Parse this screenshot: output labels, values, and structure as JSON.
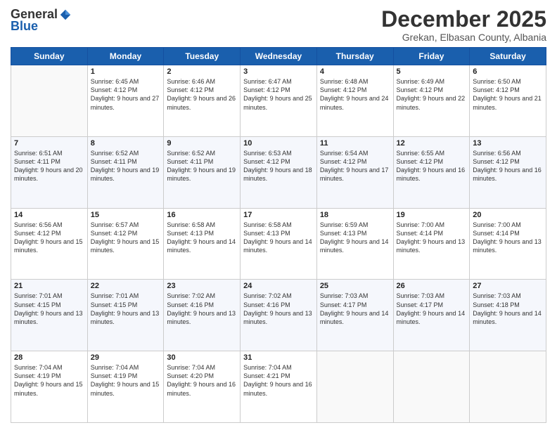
{
  "logo": {
    "general": "General",
    "blue": "Blue"
  },
  "title": "December 2025",
  "subtitle": "Grekan, Elbasan County, Albania",
  "days_header": [
    "Sunday",
    "Monday",
    "Tuesday",
    "Wednesday",
    "Thursday",
    "Friday",
    "Saturday"
  ],
  "weeks": [
    [
      {
        "day": "",
        "sunrise": "",
        "sunset": "",
        "daylight": ""
      },
      {
        "day": "1",
        "sunrise": "Sunrise: 6:45 AM",
        "sunset": "Sunset: 4:12 PM",
        "daylight": "Daylight: 9 hours and 27 minutes."
      },
      {
        "day": "2",
        "sunrise": "Sunrise: 6:46 AM",
        "sunset": "Sunset: 4:12 PM",
        "daylight": "Daylight: 9 hours and 26 minutes."
      },
      {
        "day": "3",
        "sunrise": "Sunrise: 6:47 AM",
        "sunset": "Sunset: 4:12 PM",
        "daylight": "Daylight: 9 hours and 25 minutes."
      },
      {
        "day": "4",
        "sunrise": "Sunrise: 6:48 AM",
        "sunset": "Sunset: 4:12 PM",
        "daylight": "Daylight: 9 hours and 24 minutes."
      },
      {
        "day": "5",
        "sunrise": "Sunrise: 6:49 AM",
        "sunset": "Sunset: 4:12 PM",
        "daylight": "Daylight: 9 hours and 22 minutes."
      },
      {
        "day": "6",
        "sunrise": "Sunrise: 6:50 AM",
        "sunset": "Sunset: 4:12 PM",
        "daylight": "Daylight: 9 hours and 21 minutes."
      }
    ],
    [
      {
        "day": "7",
        "sunrise": "Sunrise: 6:51 AM",
        "sunset": "Sunset: 4:11 PM",
        "daylight": "Daylight: 9 hours and 20 minutes."
      },
      {
        "day": "8",
        "sunrise": "Sunrise: 6:52 AM",
        "sunset": "Sunset: 4:11 PM",
        "daylight": "Daylight: 9 hours and 19 minutes."
      },
      {
        "day": "9",
        "sunrise": "Sunrise: 6:52 AM",
        "sunset": "Sunset: 4:11 PM",
        "daylight": "Daylight: 9 hours and 19 minutes."
      },
      {
        "day": "10",
        "sunrise": "Sunrise: 6:53 AM",
        "sunset": "Sunset: 4:12 PM",
        "daylight": "Daylight: 9 hours and 18 minutes."
      },
      {
        "day": "11",
        "sunrise": "Sunrise: 6:54 AM",
        "sunset": "Sunset: 4:12 PM",
        "daylight": "Daylight: 9 hours and 17 minutes."
      },
      {
        "day": "12",
        "sunrise": "Sunrise: 6:55 AM",
        "sunset": "Sunset: 4:12 PM",
        "daylight": "Daylight: 9 hours and 16 minutes."
      },
      {
        "day": "13",
        "sunrise": "Sunrise: 6:56 AM",
        "sunset": "Sunset: 4:12 PM",
        "daylight": "Daylight: 9 hours and 16 minutes."
      }
    ],
    [
      {
        "day": "14",
        "sunrise": "Sunrise: 6:56 AM",
        "sunset": "Sunset: 4:12 PM",
        "daylight": "Daylight: 9 hours and 15 minutes."
      },
      {
        "day": "15",
        "sunrise": "Sunrise: 6:57 AM",
        "sunset": "Sunset: 4:12 PM",
        "daylight": "Daylight: 9 hours and 15 minutes."
      },
      {
        "day": "16",
        "sunrise": "Sunrise: 6:58 AM",
        "sunset": "Sunset: 4:13 PM",
        "daylight": "Daylight: 9 hours and 14 minutes."
      },
      {
        "day": "17",
        "sunrise": "Sunrise: 6:58 AM",
        "sunset": "Sunset: 4:13 PM",
        "daylight": "Daylight: 9 hours and 14 minutes."
      },
      {
        "day": "18",
        "sunrise": "Sunrise: 6:59 AM",
        "sunset": "Sunset: 4:13 PM",
        "daylight": "Daylight: 9 hours and 14 minutes."
      },
      {
        "day": "19",
        "sunrise": "Sunrise: 7:00 AM",
        "sunset": "Sunset: 4:14 PM",
        "daylight": "Daylight: 9 hours and 13 minutes."
      },
      {
        "day": "20",
        "sunrise": "Sunrise: 7:00 AM",
        "sunset": "Sunset: 4:14 PM",
        "daylight": "Daylight: 9 hours and 13 minutes."
      }
    ],
    [
      {
        "day": "21",
        "sunrise": "Sunrise: 7:01 AM",
        "sunset": "Sunset: 4:15 PM",
        "daylight": "Daylight: 9 hours and 13 minutes."
      },
      {
        "day": "22",
        "sunrise": "Sunrise: 7:01 AM",
        "sunset": "Sunset: 4:15 PM",
        "daylight": "Daylight: 9 hours and 13 minutes."
      },
      {
        "day": "23",
        "sunrise": "Sunrise: 7:02 AM",
        "sunset": "Sunset: 4:16 PM",
        "daylight": "Daylight: 9 hours and 13 minutes."
      },
      {
        "day": "24",
        "sunrise": "Sunrise: 7:02 AM",
        "sunset": "Sunset: 4:16 PM",
        "daylight": "Daylight: 9 hours and 13 minutes."
      },
      {
        "day": "25",
        "sunrise": "Sunrise: 7:03 AM",
        "sunset": "Sunset: 4:17 PM",
        "daylight": "Daylight: 9 hours and 14 minutes."
      },
      {
        "day": "26",
        "sunrise": "Sunrise: 7:03 AM",
        "sunset": "Sunset: 4:17 PM",
        "daylight": "Daylight: 9 hours and 14 minutes."
      },
      {
        "day": "27",
        "sunrise": "Sunrise: 7:03 AM",
        "sunset": "Sunset: 4:18 PM",
        "daylight": "Daylight: 9 hours and 14 minutes."
      }
    ],
    [
      {
        "day": "28",
        "sunrise": "Sunrise: 7:04 AM",
        "sunset": "Sunset: 4:19 PM",
        "daylight": "Daylight: 9 hours and 15 minutes."
      },
      {
        "day": "29",
        "sunrise": "Sunrise: 7:04 AM",
        "sunset": "Sunset: 4:19 PM",
        "daylight": "Daylight: 9 hours and 15 minutes."
      },
      {
        "day": "30",
        "sunrise": "Sunrise: 7:04 AM",
        "sunset": "Sunset: 4:20 PM",
        "daylight": "Daylight: 9 hours and 16 minutes."
      },
      {
        "day": "31",
        "sunrise": "Sunrise: 7:04 AM",
        "sunset": "Sunset: 4:21 PM",
        "daylight": "Daylight: 9 hours and 16 minutes."
      },
      {
        "day": "",
        "sunrise": "",
        "sunset": "",
        "daylight": ""
      },
      {
        "day": "",
        "sunrise": "",
        "sunset": "",
        "daylight": ""
      },
      {
        "day": "",
        "sunrise": "",
        "sunset": "",
        "daylight": ""
      }
    ]
  ]
}
